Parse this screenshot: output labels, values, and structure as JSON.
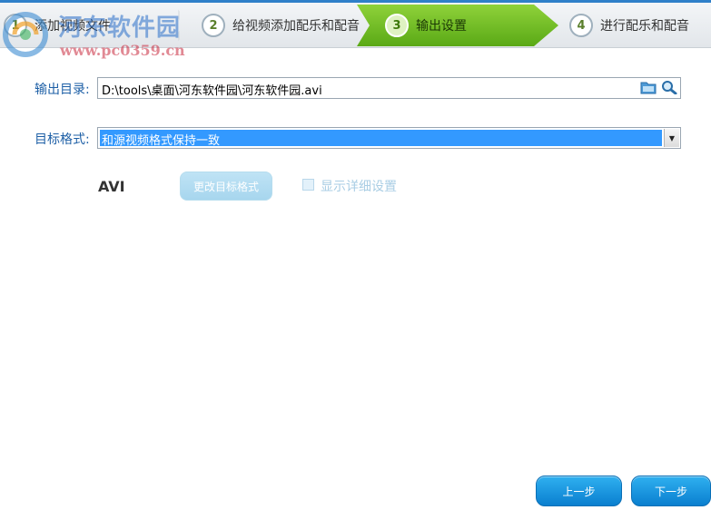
{
  "steps": [
    {
      "num": "1",
      "label": "添加视频文件"
    },
    {
      "num": "2",
      "label": "给视频添加配乐和配音"
    },
    {
      "num": "3",
      "label": "输出设置"
    },
    {
      "num": "4",
      "label": "进行配乐和配音"
    }
  ],
  "active_step": 3,
  "watermark": {
    "name": "河东软件园",
    "url": "www.pc0359.cn"
  },
  "output": {
    "label": "输出目录:",
    "path": "D:\\tools\\桌面\\河东软件园\\河东软件园.avi",
    "folder_icon": "folder-icon",
    "search_icon": "search-icon"
  },
  "format": {
    "label": "目标格式:",
    "selected": "和源视频格式保持一致",
    "format_name": "AVI",
    "change_button": "更改目标格式",
    "detail_checkbox_label": "显示详细设置",
    "detail_checked": false
  },
  "nav": {
    "prev": "上一步",
    "next": "下一步"
  },
  "colors": {
    "accent": "#2f80c9",
    "active_step": "#6bbf1e",
    "label_blue": "#1d5fa6",
    "button_blue": "#1a96e0"
  }
}
